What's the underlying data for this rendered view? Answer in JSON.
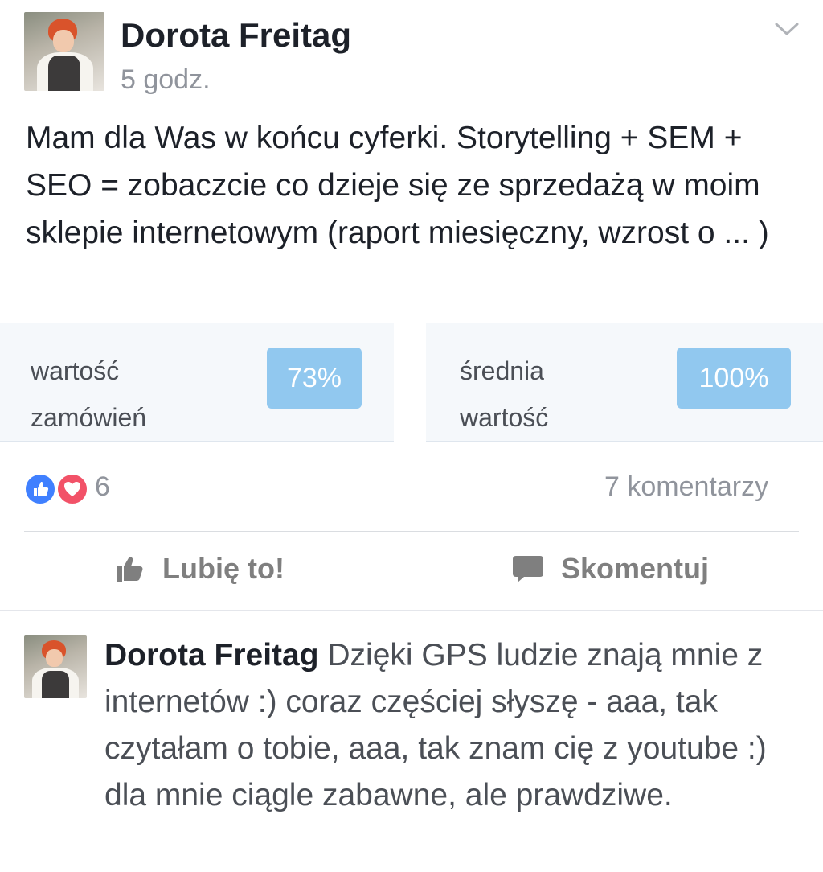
{
  "post": {
    "author": "Dorota Freitag",
    "time": "5 godz.",
    "text": "Mam dla Was w końcu cyferki. Storytelling + SEM + SEO = zobaczcie co dzieje się ze sprzedażą w moim sklepie internetowym (raport miesięczny, wzrost o ... )"
  },
  "image": {
    "metrics": [
      {
        "label_line1": "wartość",
        "label_line2": "zamówień",
        "value": "73%"
      },
      {
        "label_line1": "średnia",
        "label_line2": "wartość",
        "value": "100%"
      }
    ]
  },
  "reactions": {
    "count": "6",
    "comments": "7 komentarzy",
    "icons": [
      "like-reaction-icon",
      "love-reaction-icon"
    ]
  },
  "actions": {
    "like_label": "Lubię to!",
    "comment_label": "Skomentuj"
  },
  "comment": {
    "author": "Dorota Freitag",
    "text": "Dzięki GPS ludzie znają mnie z internetów :) coraz częściej słyszę - aaa, tak czytałam o tobie, aaa, tak znam cię z youtube :) dla mnie ciągle zabawne, ale prawdziwe."
  },
  "colors": {
    "like_blue": "#4080ff",
    "love_red": "#f25268",
    "badge_blue": "#91c8ef"
  }
}
